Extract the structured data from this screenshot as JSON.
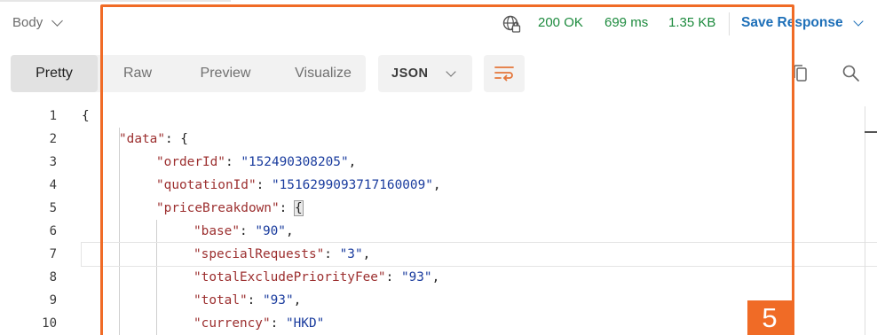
{
  "response": {
    "body_tab": "Body",
    "status": "200 OK",
    "time": "699 ms",
    "size": "1.35 KB",
    "save_label": "Save Response"
  },
  "toolbar": {
    "views": [
      "Pretty",
      "Raw",
      "Preview",
      "Visualize"
    ],
    "selected_view": "Pretty",
    "format": "JSON"
  },
  "icons": {
    "globe": "globe-icon",
    "wrap": "word-wrap-icon",
    "copy": "copy-icon",
    "search": "search-icon"
  },
  "colors": {
    "status": "#1c8a3d",
    "accent": "#1d6fb8",
    "annotation": "#f06b26",
    "json_key": "#9c2f2f",
    "json_string": "#1a3c9e"
  },
  "editor": {
    "line_numbers": [
      "1",
      "2",
      "3",
      "4",
      "5",
      "6",
      "7",
      "8",
      "9",
      "10"
    ],
    "lines": [
      {
        "key": "",
        "value": "",
        "tail": "{"
      },
      {
        "key": "\"data\"",
        "value": "",
        "tail": ": {"
      },
      {
        "key": "\"orderId\"",
        "value": "\"152490308205\"",
        "tail": ","
      },
      {
        "key": "\"quotationId\"",
        "value": "\"1516299093717160009\"",
        "tail": ","
      },
      {
        "key": "\"priceBreakdown\"",
        "value": "",
        "tail": ": "
      },
      {
        "key": "\"base\"",
        "value": "\"90\"",
        "tail": ","
      },
      {
        "key": "\"specialRequests\"",
        "value": "\"3\"",
        "tail": ","
      },
      {
        "key": "\"totalExcludePriorityFee\"",
        "value": "\"93\"",
        "tail": ","
      },
      {
        "key": "\"total\"",
        "value": "\"93\"",
        "tail": ","
      },
      {
        "key": "\"currency\"",
        "value": "\"HKD\"",
        "tail": ""
      }
    ],
    "bracket_highlight": "{"
  },
  "annotation": {
    "badge": "5"
  }
}
